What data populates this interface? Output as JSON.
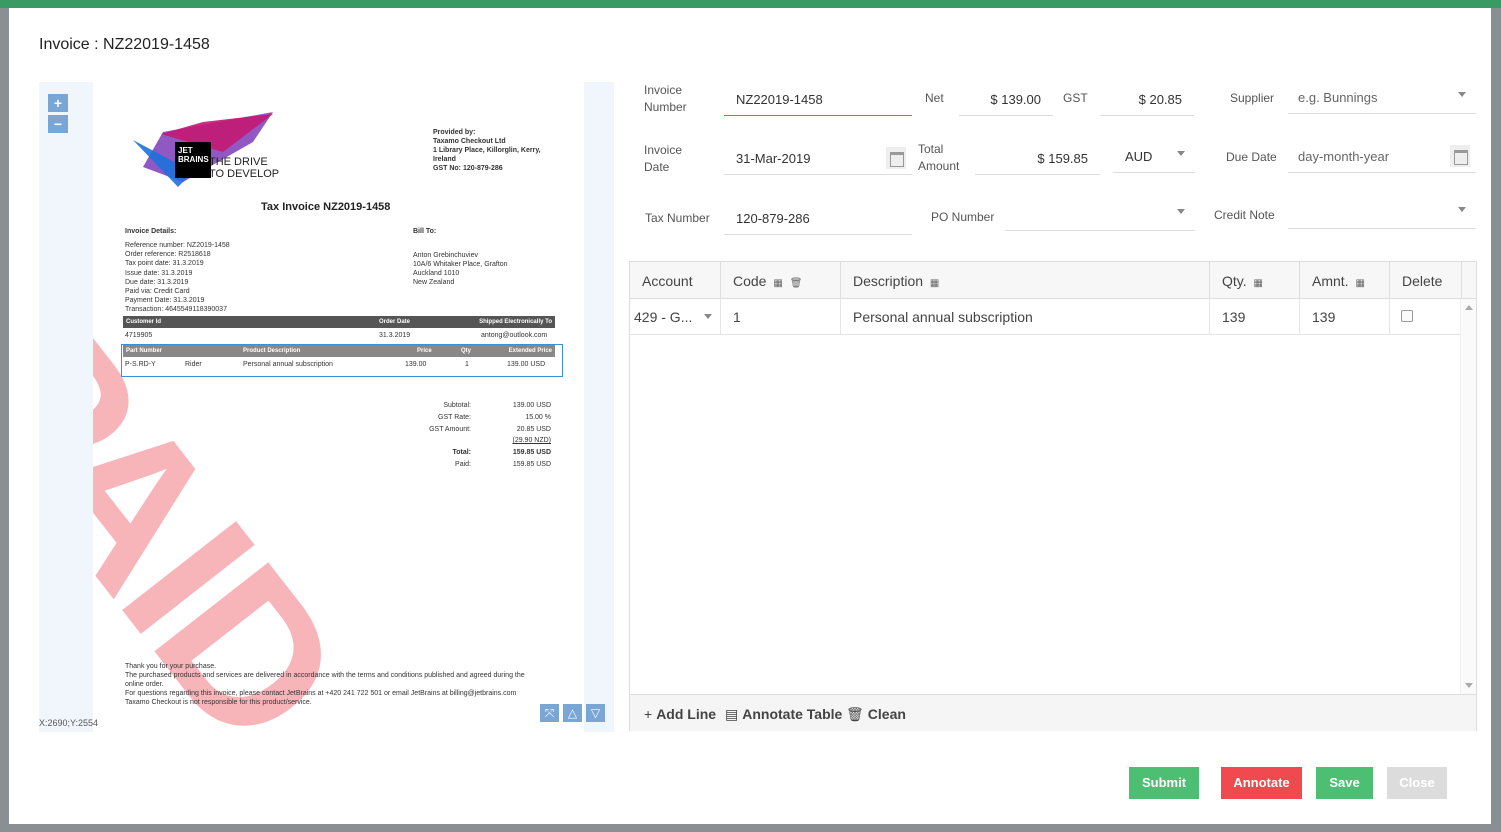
{
  "modal": {
    "title": "Invoice : NZ22019-1458"
  },
  "preview": {
    "zoom_in": "+",
    "zoom_out": "−",
    "coords": "X:2690;Y:2554",
    "nav_fit": "⤧",
    "nav_up": "△",
    "nav_down": "▽",
    "doc": {
      "logo_jb": "JET\nBRAINS",
      "logo_tagline_1": "THE DRIVE",
      "logo_tagline_2": "TO DEVELOP",
      "provided_by_lines": [
        "Provided by:",
        "Taxamo Checkout Ltd",
        "1 Library Place, Killorglin, Kerry,",
        "Ireland",
        "GST No: 120-879-286"
      ],
      "title": "Tax Invoice NZ2019-1458",
      "invoice_details_label": "Invoice Details:",
      "bill_to_label": "Bill To:",
      "details_lines": [
        "Reference number: NZ2019-1458",
        "Order reference: R2518618",
        "Tax point date: 31.3.2019",
        "Issue date: 31.3.2019",
        "Due date: 31.3.2019",
        "Paid via: Credit Card",
        "Payment Date: 31.3.2019",
        "Transaction: 4645549118390037"
      ],
      "bill_to_lines": [
        "Anton Grebinchuviev",
        "10A/6 Whitaker Place, Grafton",
        "Auckland 1010",
        "New Zealand"
      ],
      "t1_headers": [
        "Customer Id",
        "Order Date",
        "Shipped Electronically To"
      ],
      "t1_values": [
        "4719905",
        "31.3.2019",
        "antong@outlook.com"
      ],
      "t2_headers": [
        "Part Number",
        "Product Description",
        "Price",
        "Qty",
        "Extended Price"
      ],
      "t2_values": [
        "P-S.RD-Y",
        "Rider",
        "Personal annual subscription",
        "139.00",
        "1",
        "139.00 USD"
      ],
      "totals_labels": [
        "Subtotal:",
        "GST Rate:",
        "GST Amount:",
        "",
        "Total:",
        "Paid:"
      ],
      "totals_values": [
        "139.00 USD",
        "15.00 %",
        "20.85 USD",
        "(29.90 NZD)",
        "159.85 USD",
        "159.85 USD"
      ],
      "stamp": "PAID",
      "footer_lines": [
        "Thank you for your purchase.",
        "The purchased products and services are delivered in accordance with the terms and conditions published and agreed during the",
        "online order.",
        "For questions regarding this invoice, please contact JetBrains at +420 241 722 501 or email JetBrains at billing@jetbrains.com",
        "Taxamo Checkout is not responsible for this product/service."
      ]
    }
  },
  "form": {
    "invoice_number_label": "Invoice\nNumber",
    "invoice_number_value": "NZ22019-1458",
    "net_label": "Net",
    "net_value": "$ 139.00",
    "gst_label": "GST",
    "gst_value": "$ 20.85",
    "supplier_label": "Supplier",
    "supplier_placeholder": "e.g. Bunnings",
    "invoice_date_label": "Invoice\nDate",
    "invoice_date_value": "31-Mar-2019",
    "total_amount_label": "Total\nAmount",
    "total_amount_value": "$ 159.85",
    "currency_value": "AUD",
    "due_date_label": "Due Date",
    "due_date_placeholder": "day-month-year",
    "tax_number_label": "Tax Number",
    "tax_number_value": "120-879-286",
    "po_number_label": "PO Number",
    "po_number_value": "",
    "credit_note_label": "Credit Note",
    "credit_note_value": ""
  },
  "grid": {
    "headers": {
      "account": "Account",
      "code": "Code",
      "description": "Description",
      "qty": "Qty.",
      "amnt": "Amnt.",
      "delete": "Delete"
    },
    "rows": [
      {
        "account": "429 - G...",
        "code": "1",
        "description": "Personal annual subscription",
        "qty": "139",
        "amnt": "139",
        "delete": false
      }
    ],
    "footer": {
      "add_line": "Add Line",
      "annotate_table": "Annotate Table",
      "clean": "Clean"
    }
  },
  "actions": {
    "submit": "Submit",
    "annotate": "Annotate",
    "save": "Save",
    "close": "Close"
  },
  "colors": {
    "header_bar": "#3a9a63",
    "submit": "#4cbf73",
    "annotate": "#f0494f",
    "save": "#4cbf73",
    "close": "#dcdcdc",
    "stamp": "#f07882"
  },
  "icons": {
    "calendar": "calendar-icon",
    "caret": "chevron-down-icon",
    "trash": "trash-icon",
    "columns": "columns-icon",
    "plus": "plus-icon",
    "table": "table-icon"
  }
}
